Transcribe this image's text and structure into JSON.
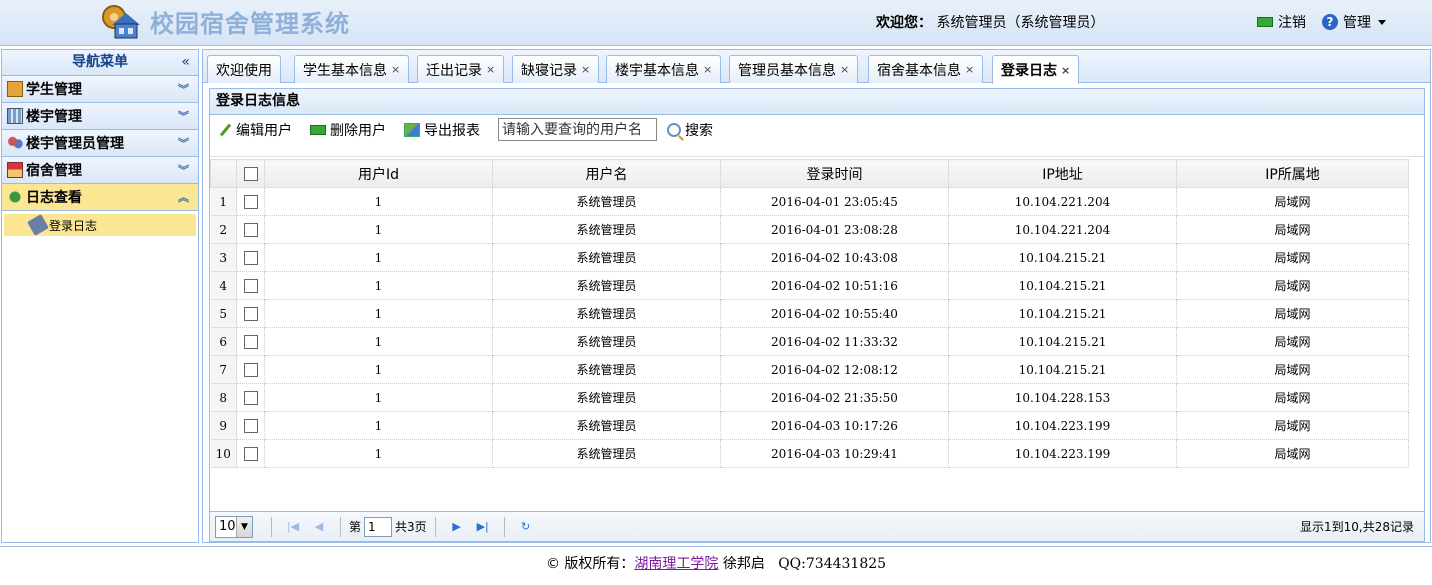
{
  "header": {
    "app_title": "校园宿舍管理系统",
    "welcome_label": "欢迎您：",
    "welcome_user": "系统管理员（系统管理员）",
    "logout": "注销",
    "manage": "管理"
  },
  "nav": {
    "title": "导航菜单",
    "groups": [
      {
        "label": "学生管理"
      },
      {
        "label": "楼宇管理"
      },
      {
        "label": "楼宇管理员管理"
      },
      {
        "label": "宿舍管理"
      },
      {
        "label": "日志查看"
      }
    ],
    "sub_item": "登录日志"
  },
  "tabs": [
    {
      "label": "欢迎使用"
    },
    {
      "label": "学生基本信息"
    },
    {
      "label": "迁出记录"
    },
    {
      "label": "缺寝记录"
    },
    {
      "label": "楼宇基本信息"
    },
    {
      "label": "管理员基本信息"
    },
    {
      "label": "宿舍基本信息"
    },
    {
      "label": "登录日志"
    }
  ],
  "panel": {
    "title": "登录日志信息",
    "toolbar": {
      "edit": "编辑用户",
      "delete": "删除用户",
      "export": "导出报表",
      "search_placeholder": "请输入要查询的用户名",
      "search": "搜索"
    }
  },
  "table": {
    "columns": [
      "用户Id",
      "用户名",
      "登录时间",
      "IP地址",
      "IP所属地"
    ],
    "rows": [
      [
        "1",
        "1",
        "系统管理员",
        "2016-04-01 23:05:45",
        "10.104.221.204",
        "局域网"
      ],
      [
        "2",
        "1",
        "系统管理员",
        "2016-04-01 23:08:28",
        "10.104.221.204",
        "局域网"
      ],
      [
        "3",
        "1",
        "系统管理员",
        "2016-04-02 10:43:08",
        "10.104.215.21",
        "局域网"
      ],
      [
        "4",
        "1",
        "系统管理员",
        "2016-04-02 10:51:16",
        "10.104.215.21",
        "局域网"
      ],
      [
        "5",
        "1",
        "系统管理员",
        "2016-04-02 10:55:40",
        "10.104.215.21",
        "局域网"
      ],
      [
        "6",
        "1",
        "系统管理员",
        "2016-04-02 11:33:32",
        "10.104.215.21",
        "局域网"
      ],
      [
        "7",
        "1",
        "系统管理员",
        "2016-04-02 12:08:12",
        "10.104.215.21",
        "局域网"
      ],
      [
        "8",
        "1",
        "系统管理员",
        "2016-04-02 21:35:50",
        "10.104.228.153",
        "局域网"
      ],
      [
        "9",
        "1",
        "系统管理员",
        "2016-04-03 10:17:26",
        "10.104.223.199",
        "局域网"
      ],
      [
        "10",
        "1",
        "系统管理员",
        "2016-04-03 10:29:41",
        "10.104.223.199",
        "局域网"
      ]
    ]
  },
  "pager": {
    "page_size": "10",
    "page_prefix": "第",
    "page": "1",
    "total_pages": "共3页",
    "info": "显示1到10,共28记录"
  },
  "footer": {
    "copyright": "© 版权所有：",
    "school": "湖南理工学院",
    "author": "徐邦启",
    "qq": "QQ:734431825"
  }
}
